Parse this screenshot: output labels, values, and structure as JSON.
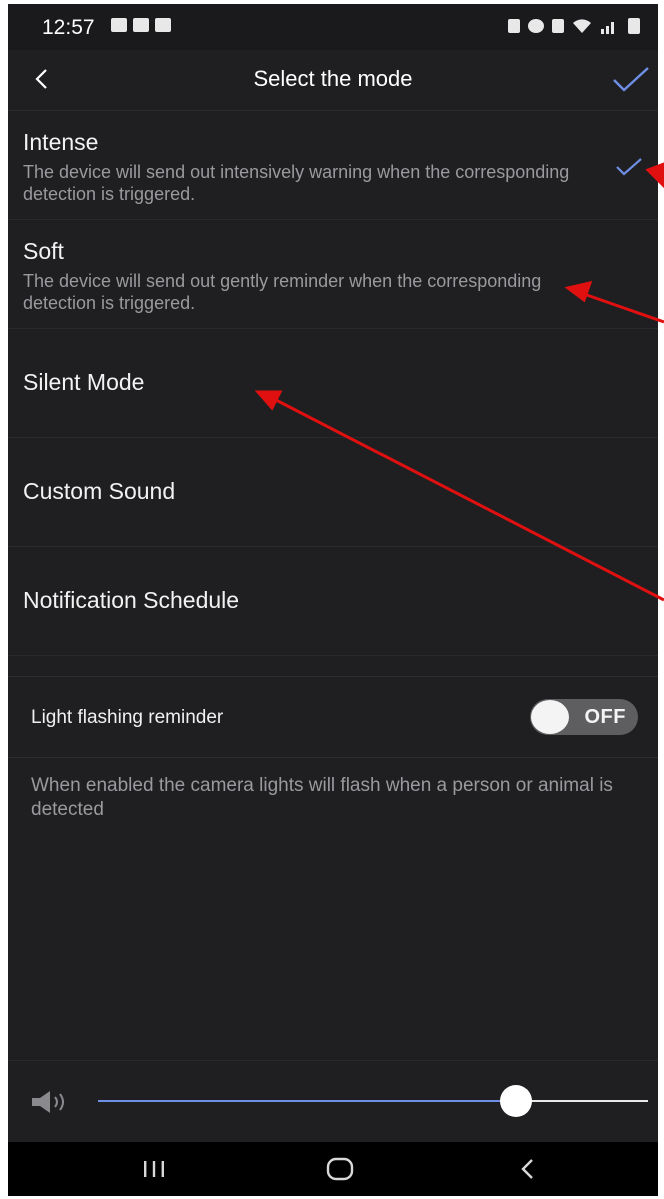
{
  "status_bar": {
    "time": "12:57",
    "left_icons": [
      "image-icon",
      "calendar-icon",
      "download-icon"
    ],
    "right_icons": [
      "lock-icon",
      "alarm-icon",
      "mute-icon",
      "wifi-icon",
      "signal-icon",
      "battery-icon"
    ]
  },
  "header": {
    "title": "Select the mode",
    "back_icon": "chevron-left-icon",
    "confirm_icon": "checkmark-icon"
  },
  "modes": [
    {
      "title": "Intense",
      "description": "The device will send out intensively warning when the corresponding detection is triggered.",
      "selected": true
    },
    {
      "title": "Soft",
      "description": "The device will send out gently reminder when the corresponding detection is triggered.",
      "selected": false
    },
    {
      "title": "Silent Mode"
    },
    {
      "title": "Custom Sound"
    },
    {
      "title": "Notification Schedule"
    }
  ],
  "light_flashing": {
    "label": "Light flashing reminder",
    "toggle_state": "OFF",
    "help_text": "When enabled the camera lights will flash when a person or animal is detected"
  },
  "volume": {
    "icon": "speaker-icon",
    "level_fraction": 0.76
  },
  "nav_bar": {
    "buttons": [
      "recent-apps-icon",
      "home-icon",
      "back-icon"
    ]
  },
  "colors": {
    "background": "#1f1f21",
    "accent": "#6e8fe6",
    "annotation": "#e01010"
  }
}
